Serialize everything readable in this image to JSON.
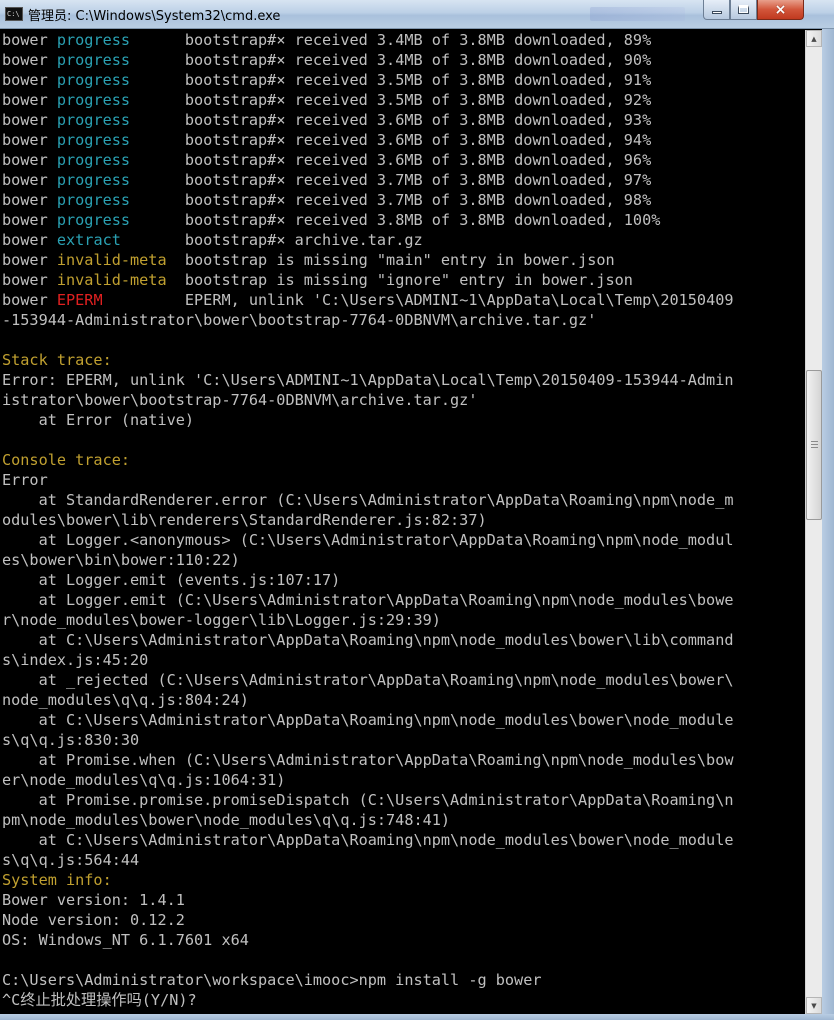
{
  "window": {
    "title": "管理员: C:\\Windows\\System32\\cmd.exe",
    "icon_label": "C:\\",
    "buttons": {
      "minimize": "minimize-icon",
      "maximize": "maximize-icon",
      "close": "×"
    }
  },
  "colors": {
    "background": "#000000",
    "text": "#c0c0c0",
    "progress": "#2aa1b3",
    "warning": "#c0a030",
    "error": "#e02020"
  },
  "lines": [
    [
      {
        "t": "bower ",
        "c": "gray"
      },
      {
        "t": "progress",
        "c": "cyan"
      },
      {
        "t": "      bootstrap#× received 3.4MB of 3.8MB downloaded, 89%",
        "c": "gray"
      }
    ],
    [
      {
        "t": "bower ",
        "c": "gray"
      },
      {
        "t": "progress",
        "c": "cyan"
      },
      {
        "t": "      bootstrap#× received 3.4MB of 3.8MB downloaded, 90%",
        "c": "gray"
      }
    ],
    [
      {
        "t": "bower ",
        "c": "gray"
      },
      {
        "t": "progress",
        "c": "cyan"
      },
      {
        "t": "      bootstrap#× received 3.5MB of 3.8MB downloaded, 91%",
        "c": "gray"
      }
    ],
    [
      {
        "t": "bower ",
        "c": "gray"
      },
      {
        "t": "progress",
        "c": "cyan"
      },
      {
        "t": "      bootstrap#× received 3.5MB of 3.8MB downloaded, 92%",
        "c": "gray"
      }
    ],
    [
      {
        "t": "bower ",
        "c": "gray"
      },
      {
        "t": "progress",
        "c": "cyan"
      },
      {
        "t": "      bootstrap#× received 3.6MB of 3.8MB downloaded, 93%",
        "c": "gray"
      }
    ],
    [
      {
        "t": "bower ",
        "c": "gray"
      },
      {
        "t": "progress",
        "c": "cyan"
      },
      {
        "t": "      bootstrap#× received 3.6MB of 3.8MB downloaded, 94%",
        "c": "gray"
      }
    ],
    [
      {
        "t": "bower ",
        "c": "gray"
      },
      {
        "t": "progress",
        "c": "cyan"
      },
      {
        "t": "      bootstrap#× received 3.6MB of 3.8MB downloaded, 96%",
        "c": "gray"
      }
    ],
    [
      {
        "t": "bower ",
        "c": "gray"
      },
      {
        "t": "progress",
        "c": "cyan"
      },
      {
        "t": "      bootstrap#× received 3.7MB of 3.8MB downloaded, 97%",
        "c": "gray"
      }
    ],
    [
      {
        "t": "bower ",
        "c": "gray"
      },
      {
        "t": "progress",
        "c": "cyan"
      },
      {
        "t": "      bootstrap#× received 3.7MB of 3.8MB downloaded, 98%",
        "c": "gray"
      }
    ],
    [
      {
        "t": "bower ",
        "c": "gray"
      },
      {
        "t": "progress",
        "c": "cyan"
      },
      {
        "t": "      bootstrap#× received 3.8MB of 3.8MB downloaded, 100%",
        "c": "gray"
      }
    ],
    [
      {
        "t": "bower ",
        "c": "gray"
      },
      {
        "t": "extract",
        "c": "cyan"
      },
      {
        "t": "       bootstrap#× archive.tar.gz",
        "c": "gray"
      }
    ],
    [
      {
        "t": "bower ",
        "c": "gray"
      },
      {
        "t": "invalid-meta",
        "c": "yellow"
      },
      {
        "t": "  bootstrap is missing \"main\" entry in bower.json",
        "c": "gray"
      }
    ],
    [
      {
        "t": "bower ",
        "c": "gray"
      },
      {
        "t": "invalid-meta",
        "c": "yellow"
      },
      {
        "t": "  bootstrap is missing \"ignore\" entry in bower.json",
        "c": "gray"
      }
    ],
    [
      {
        "t": "bower ",
        "c": "gray"
      },
      {
        "t": "EPERM",
        "c": "red"
      },
      {
        "t": "         EPERM, unlink 'C:\\Users\\ADMINI~1\\AppData\\Local\\Temp\\20150409",
        "c": "gray"
      }
    ],
    [
      {
        "t": "-153944-Administrator\\bower\\bootstrap-7764-0DBNVM\\archive.tar.gz'",
        "c": "gray"
      }
    ],
    [
      {
        "t": "",
        "c": "gray"
      }
    ],
    [
      {
        "t": "Stack trace:",
        "c": "yellow"
      }
    ],
    [
      {
        "t": "Error: EPERM, unlink 'C:\\Users\\ADMINI~1\\AppData\\Local\\Temp\\20150409-153944-Admin",
        "c": "gray"
      }
    ],
    [
      {
        "t": "istrator\\bower\\bootstrap-7764-0DBNVM\\archive.tar.gz'",
        "c": "gray"
      }
    ],
    [
      {
        "t": "    at Error (native)",
        "c": "gray"
      }
    ],
    [
      {
        "t": "",
        "c": "gray"
      }
    ],
    [
      {
        "t": "Console trace:",
        "c": "yellow"
      }
    ],
    [
      {
        "t": "Error",
        "c": "gray"
      }
    ],
    [
      {
        "t": "    at StandardRenderer.error (C:\\Users\\Administrator\\AppData\\Roaming\\npm\\node_m",
        "c": "gray"
      }
    ],
    [
      {
        "t": "odules\\bower\\lib\\renderers\\StandardRenderer.js:82:37)",
        "c": "gray"
      }
    ],
    [
      {
        "t": "    at Logger.<anonymous> (C:\\Users\\Administrator\\AppData\\Roaming\\npm\\node_modul",
        "c": "gray"
      }
    ],
    [
      {
        "t": "es\\bower\\bin\\bower:110:22)",
        "c": "gray"
      }
    ],
    [
      {
        "t": "    at Logger.emit (events.js:107:17)",
        "c": "gray"
      }
    ],
    [
      {
        "t": "    at Logger.emit (C:\\Users\\Administrator\\AppData\\Roaming\\npm\\node_modules\\bowe",
        "c": "gray"
      }
    ],
    [
      {
        "t": "r\\node_modules\\bower-logger\\lib\\Logger.js:29:39)",
        "c": "gray"
      }
    ],
    [
      {
        "t": "    at C:\\Users\\Administrator\\AppData\\Roaming\\npm\\node_modules\\bower\\lib\\command",
        "c": "gray"
      }
    ],
    [
      {
        "t": "s\\index.js:45:20",
        "c": "gray"
      }
    ],
    [
      {
        "t": "    at _rejected (C:\\Users\\Administrator\\AppData\\Roaming\\npm\\node_modules\\bower\\",
        "c": "gray"
      }
    ],
    [
      {
        "t": "node_modules\\q\\q.js:804:24)",
        "c": "gray"
      }
    ],
    [
      {
        "t": "    at C:\\Users\\Administrator\\AppData\\Roaming\\npm\\node_modules\\bower\\node_module",
        "c": "gray"
      }
    ],
    [
      {
        "t": "s\\q\\q.js:830:30",
        "c": "gray"
      }
    ],
    [
      {
        "t": "    at Promise.when (C:\\Users\\Administrator\\AppData\\Roaming\\npm\\node_modules\\bow",
        "c": "gray"
      }
    ],
    [
      {
        "t": "er\\node_modules\\q\\q.js:1064:31)",
        "c": "gray"
      }
    ],
    [
      {
        "t": "    at Promise.promise.promiseDispatch (C:\\Users\\Administrator\\AppData\\Roaming\\n",
        "c": "gray"
      }
    ],
    [
      {
        "t": "pm\\node_modules\\bower\\node_modules\\q\\q.js:748:41)",
        "c": "gray"
      }
    ],
    [
      {
        "t": "    at C:\\Users\\Administrator\\AppData\\Roaming\\npm\\node_modules\\bower\\node_module",
        "c": "gray"
      }
    ],
    [
      {
        "t": "s\\q\\q.js:564:44",
        "c": "gray"
      }
    ],
    [
      {
        "t": "System info:",
        "c": "yellow"
      }
    ],
    [
      {
        "t": "Bower version: 1.4.1",
        "c": "gray"
      }
    ],
    [
      {
        "t": "Node version: 0.12.2",
        "c": "gray"
      }
    ],
    [
      {
        "t": "OS: Windows_NT 6.1.7601 x64",
        "c": "gray"
      }
    ],
    [
      {
        "t": "",
        "c": "gray"
      }
    ],
    [
      {
        "t": "C:\\Users\\Administrator\\workspace\\imooc>npm install -g bower",
        "c": "gray"
      }
    ],
    [
      {
        "t": "^C终止批处理操作吗(Y/N)?",
        "c": "gray"
      }
    ]
  ]
}
